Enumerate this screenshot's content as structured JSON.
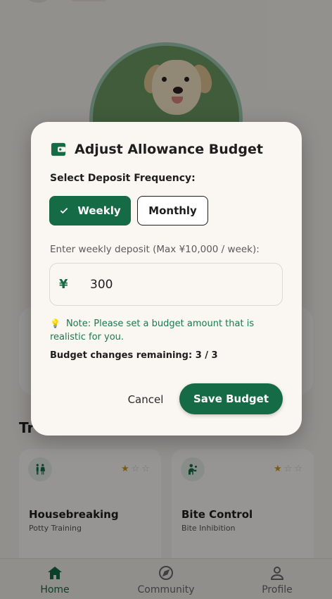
{
  "background": {
    "section_title": "Tr",
    "training_cards": [
      {
        "name": "Housebreaking",
        "subtitle": "Potty Training",
        "icon": "toilet-icon",
        "rating": 1,
        "max_rating": 5
      },
      {
        "name": "Bite Control",
        "subtitle": "Bite Inhibition",
        "icon": "dog-sitting-icon",
        "rating": 1,
        "max_rating": 5
      }
    ],
    "bottom_nav": [
      {
        "label": "Home",
        "icon": "home-icon",
        "active": true
      },
      {
        "label": "Community",
        "icon": "compass-icon",
        "active": false
      },
      {
        "label": "Profile",
        "icon": "person-icon",
        "active": false
      }
    ]
  },
  "dialog": {
    "icon": "wallet-icon",
    "title": "Adjust Allowance Budget",
    "frequency_label": "Select Deposit Frequency:",
    "options": [
      {
        "label": "Weekly",
        "selected": true
      },
      {
        "label": "Monthly",
        "selected": false
      }
    ],
    "deposit_label": "Enter weekly deposit (Max ¥10,000 / week):",
    "currency_symbol": "¥",
    "amount_value": "300",
    "note_icon": "lightbulb-icon",
    "note_text": "Note: Please set a budget amount that is realistic for you.",
    "changes_remaining": "Budget changes remaining: 3 / 3",
    "cancel_label": "Cancel",
    "save_label": "Save Budget"
  },
  "colors": {
    "primary": "#146b45",
    "surface": "#faf6f1",
    "note_text": "#1a7a4d",
    "star": "#c79a1c"
  }
}
